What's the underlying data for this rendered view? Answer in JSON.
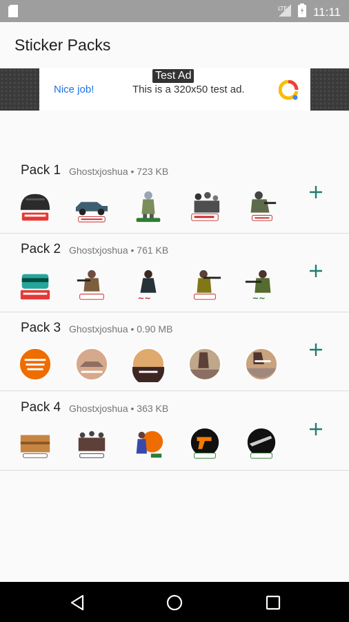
{
  "status_bar": {
    "time": "11:11",
    "network": "LTE"
  },
  "app_bar": {
    "title": "Sticker Packs"
  },
  "ad": {
    "label": "Test Ad",
    "nice_job": "Nice job!",
    "text": "This is a 320x50 test ad."
  },
  "packs": [
    {
      "title": "Pack 1",
      "author": "Ghostxjoshua",
      "separator": "•",
      "size": "723 KB"
    },
    {
      "title": "Pack 2",
      "author": "Ghostxjoshua",
      "separator": "•",
      "size": "761 KB"
    },
    {
      "title": "Pack 3",
      "author": "Ghostxjoshua",
      "separator": "•",
      "size": "0.90 MB"
    },
    {
      "title": "Pack 4",
      "author": "Ghostxjoshua",
      "separator": "•",
      "size": "363 KB"
    }
  ],
  "colors": {
    "accent": "#1e7d6e",
    "ad_link": "#1a73e8",
    "status_bar": "#9e9e9e"
  }
}
